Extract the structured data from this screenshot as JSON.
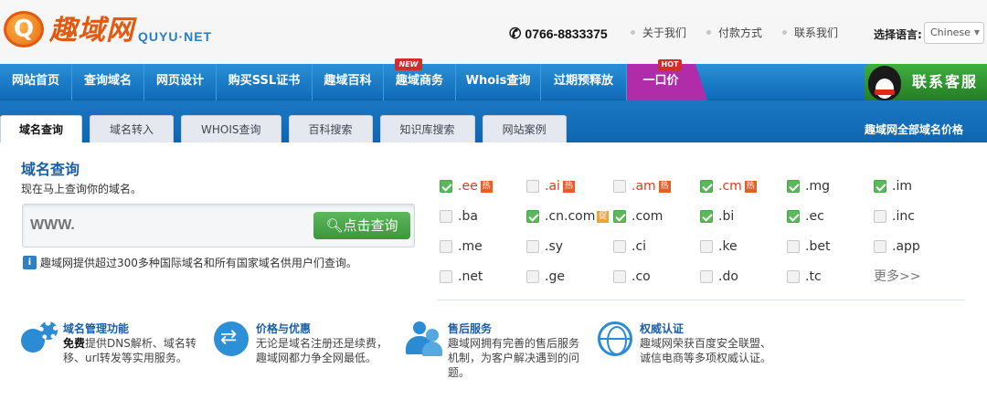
{
  "header": {
    "logo_cn": "趣域网",
    "logo_en": "QUYU·NET",
    "logo_badge": "Q",
    "phone": "0766-8833375",
    "links": [
      "关于我们",
      "付款方式",
      "联系我们"
    ],
    "lang_label": "选择语言:",
    "lang_value": "Chinese"
  },
  "nav": {
    "items": [
      "网站首页",
      "查询域名",
      "网页设计",
      "购买SSL证书",
      "趣域百科",
      "趣域商务",
      "Whois查询",
      "过期预释放"
    ],
    "new_tag": "NEW",
    "yikou": "一口价",
    "hot_tag": "HOT",
    "kefu": "联系客服"
  },
  "tabs": {
    "items": [
      "域名查询",
      "域名转入",
      "WHOIS查询",
      "百科搜索",
      "知识库搜索",
      "网站案例"
    ],
    "active_index": 0,
    "right_link": "趣域网全部域名价格"
  },
  "query": {
    "title": "域名查询",
    "subtitle": "现在马上查询你的域名。",
    "input_placeholder": "WWW.",
    "button": "点击查询",
    "info": "趣域网提供超过300多种国际域名和所有国家域名供用户们查询。",
    "info_icon": "i"
  },
  "domains": [
    {
      "name": ".ee",
      "checked": true,
      "tag": "热",
      "red": true
    },
    {
      "name": ".ai",
      "checked": false,
      "tag": "热",
      "red": true
    },
    {
      "name": ".am",
      "checked": false,
      "tag": "热",
      "red": true
    },
    {
      "name": ".cm",
      "checked": true,
      "tag": "热",
      "red": true
    },
    {
      "name": ".mg",
      "checked": true,
      "tag": "",
      "red": false
    },
    {
      "name": ".im",
      "checked": true,
      "tag": "",
      "red": false
    },
    {
      "name": ".ba",
      "checked": false,
      "tag": "",
      "red": false
    },
    {
      "name": ".cn.com",
      "checked": true,
      "tag": "促",
      "red": false
    },
    {
      "name": ".com",
      "checked": true,
      "tag": "",
      "red": false
    },
    {
      "name": ".bi",
      "checked": true,
      "tag": "",
      "red": false
    },
    {
      "name": ".ec",
      "checked": true,
      "tag": "",
      "red": false
    },
    {
      "name": ".inc",
      "checked": false,
      "tag": "",
      "red": false
    },
    {
      "name": ".me",
      "checked": false,
      "tag": "",
      "red": false
    },
    {
      "name": ".sy",
      "checked": false,
      "tag": "",
      "red": false
    },
    {
      "name": ".ci",
      "checked": false,
      "tag": "",
      "red": false
    },
    {
      "name": ".ke",
      "checked": false,
      "tag": "",
      "red": false
    },
    {
      "name": ".bet",
      "checked": false,
      "tag": "",
      "red": false
    },
    {
      "name": ".app",
      "checked": false,
      "tag": "",
      "red": false
    },
    {
      "name": ".net",
      "checked": false,
      "tag": "",
      "red": false
    },
    {
      "name": ".ge",
      "checked": false,
      "tag": "",
      "red": false
    },
    {
      "name": ".co",
      "checked": false,
      "tag": "",
      "red": false
    },
    {
      "name": ".do",
      "checked": false,
      "tag": "",
      "red": false
    },
    {
      "name": ".tc",
      "checked": false,
      "tag": "",
      "red": false
    }
  ],
  "more": "更多>>",
  "features": [
    {
      "title": "域名管理功能",
      "bold": "免费",
      "desc": "提供DNS解析、域名转移、url转发等实用服务。"
    },
    {
      "title": "价格与优惠",
      "bold": "",
      "desc": "无论是域名注册还是续费，趣域网都力争全网最低。"
    },
    {
      "title": "售后服务",
      "bold": "",
      "desc": "趣域网拥有完善的售后服务机制，为客户解决遇到的问题。"
    },
    {
      "title": "权威认证",
      "bold": "",
      "desc": "趣域网荣获百度安全联盟、诚信电商等多项权威认证。"
    }
  ]
}
